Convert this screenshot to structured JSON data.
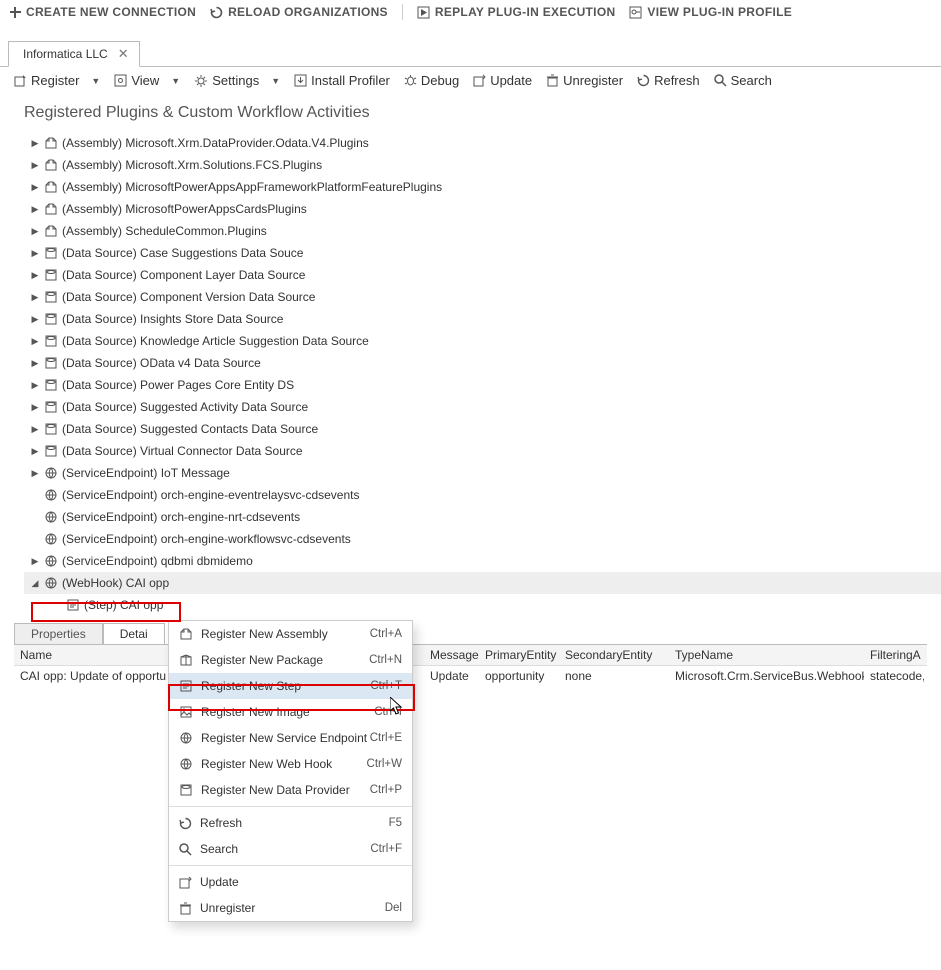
{
  "top_toolbar": {
    "create": "CREATE NEW CONNECTION",
    "reload": "RELOAD ORGANIZATIONS",
    "replay": "REPLAY PLUG-IN EXECUTION",
    "view_profile": "VIEW PLUG-IN PROFILE"
  },
  "tab": {
    "label": "Informatica LLC"
  },
  "toolbar": {
    "register": "Register",
    "view": "View",
    "settings": "Settings",
    "install_profiler": "Install Profiler",
    "debug": "Debug",
    "update": "Update",
    "unregister": "Unregister",
    "refresh": "Refresh",
    "search": "Search"
  },
  "tree": {
    "title": "Registered Plugins & Custom Workflow Activities",
    "items": [
      {
        "type": "assembly",
        "label": "(Assembly) Microsoft.Xrm.DataProvider.Odata.V4.Plugins",
        "expandable": true
      },
      {
        "type": "assembly",
        "label": "(Assembly) Microsoft.Xrm.Solutions.FCS.Plugins",
        "expandable": true
      },
      {
        "type": "assembly",
        "label": "(Assembly) MicrosoftPowerAppsAppFrameworkPlatformFeaturePlugins",
        "expandable": true
      },
      {
        "type": "assembly",
        "label": "(Assembly) MicrosoftPowerAppsCardsPlugins",
        "expandable": true
      },
      {
        "type": "assembly",
        "label": "(Assembly) ScheduleCommon.Plugins",
        "expandable": true
      },
      {
        "type": "datasource",
        "label": "(Data Source) Case Suggestions Data Souce",
        "expandable": true
      },
      {
        "type": "datasource",
        "label": "(Data Source) Component Layer Data Source",
        "expandable": true
      },
      {
        "type": "datasource",
        "label": "(Data Source) Component Version Data Source",
        "expandable": true
      },
      {
        "type": "datasource",
        "label": "(Data Source) Insights Store Data Source",
        "expandable": true
      },
      {
        "type": "datasource",
        "label": "(Data Source) Knowledge Article Suggestion Data Source",
        "expandable": true
      },
      {
        "type": "datasource",
        "label": "(Data Source) OData v4 Data Source",
        "expandable": true
      },
      {
        "type": "datasource",
        "label": "(Data Source) Power Pages Core Entity DS",
        "expandable": true
      },
      {
        "type": "datasource",
        "label": "(Data Source) Suggested Activity Data Source",
        "expandable": true
      },
      {
        "type": "datasource",
        "label": "(Data Source) Suggested Contacts Data Source",
        "expandable": true
      },
      {
        "type": "datasource",
        "label": "(Data Source) Virtual Connector Data Source",
        "expandable": true
      },
      {
        "type": "endpoint",
        "label": "(ServiceEndpoint) IoT Message",
        "expandable": true
      },
      {
        "type": "endpoint",
        "label": "(ServiceEndpoint) orch-engine-eventrelaysvc-cdsevents",
        "expandable": false
      },
      {
        "type": "endpoint",
        "label": "(ServiceEndpoint) orch-engine-nrt-cdsevents",
        "expandable": false
      },
      {
        "type": "endpoint",
        "label": "(ServiceEndpoint) orch-engine-workflowsvc-cdsevents",
        "expandable": false
      },
      {
        "type": "endpoint",
        "label": "(ServiceEndpoint) qdbmi dbmidemo",
        "expandable": true
      },
      {
        "type": "webhook",
        "label": "(WebHook) CAI opp",
        "expandable": true,
        "expanded": true,
        "selected": true
      },
      {
        "type": "step",
        "label": "(Step) CAI opp",
        "child": true
      }
    ]
  },
  "lower_tabs": {
    "properties": "Properties",
    "details": "Detai"
  },
  "grid": {
    "headers": [
      "Name",
      "Message",
      "PrimaryEntity",
      "SecondaryEntity",
      "TypeName",
      "FilteringA"
    ],
    "row": {
      "name": "CAI opp: Update of opportu",
      "message": "Update",
      "primary": "opportunity",
      "secondary": "none",
      "type": "Microsoft.Crm.ServiceBus.WebhookPlugin",
      "filter": "statecode,"
    }
  },
  "context_menu": {
    "groups": [
      [
        {
          "label": "Register New Assembly",
          "shortcut": "Ctrl+A",
          "icon": "assembly"
        },
        {
          "label": "Register New Package",
          "shortcut": "Ctrl+N",
          "icon": "package"
        },
        {
          "label": "Register New Step",
          "shortcut": "Ctrl+T",
          "icon": "step",
          "selected": true
        },
        {
          "label": "Register New Image",
          "shortcut": "Ctrl+I",
          "icon": "image"
        },
        {
          "label": "Register New Service Endpoint",
          "shortcut": "Ctrl+E",
          "icon": "endpoint"
        },
        {
          "label": "Register New Web Hook",
          "shortcut": "Ctrl+W",
          "icon": "webhook"
        },
        {
          "label": "Register New Data Provider",
          "shortcut": "Ctrl+P",
          "icon": "provider"
        }
      ],
      [
        {
          "label": "Refresh",
          "shortcut": "F5",
          "icon": "refresh"
        },
        {
          "label": "Search",
          "shortcut": "Ctrl+F",
          "icon": "search"
        }
      ],
      [
        {
          "label": "Update",
          "shortcut": "",
          "icon": "update"
        },
        {
          "label": "Unregister",
          "shortcut": "Del",
          "icon": "unregister"
        }
      ]
    ]
  }
}
